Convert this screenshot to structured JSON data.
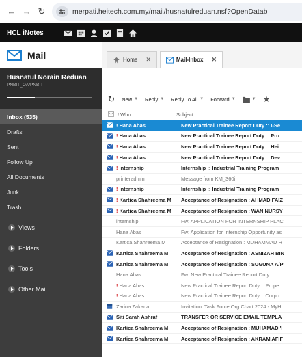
{
  "browser": {
    "url": "merpati.heitech.com.my/mail/husnatulreduan.nsf?OpenDatab"
  },
  "app": {
    "title": "HCL iNotes"
  },
  "sidebar": {
    "mail_title": "Mail",
    "user_name": "Husnatul Norain Reduan",
    "user_sub": "PNBIT_OA/PNBIT",
    "quota_fraction": 0.33,
    "folders": [
      {
        "label": "Inbox (535)",
        "active": true
      },
      {
        "label": "Drafts"
      },
      {
        "label": "Sent"
      },
      {
        "label": "Follow Up"
      },
      {
        "label": "All Documents"
      },
      {
        "label": "Junk"
      },
      {
        "label": "Trash"
      }
    ],
    "sections": [
      {
        "label": "Views"
      },
      {
        "label": "Folders"
      },
      {
        "label": "Tools"
      },
      {
        "label": "Other Mail"
      }
    ]
  },
  "tabs": [
    {
      "label": "Home"
    },
    {
      "label": "Mail-Inbox"
    }
  ],
  "toolbar": {
    "new": "New",
    "reply": "Reply",
    "reply_all": "Reply To All",
    "forward": "Forward"
  },
  "columns": {
    "who": "! Who",
    "subject": "Subject"
  },
  "messages": [
    {
      "who": "Hana Abas",
      "subject": "New Practical Trainee Report Duty  ::  I-Se",
      "important": true,
      "unread": true,
      "selected": true,
      "icon": "mail"
    },
    {
      "who": "Hana Abas",
      "subject": "New Practical Trainee Report Duty  ::  Pro",
      "important": true,
      "unread": true,
      "icon": "mail"
    },
    {
      "who": "Hana Abas",
      "subject": "New Practical Trainee Report Duty  ::  Hei",
      "important": true,
      "unread": true,
      "icon": "mail"
    },
    {
      "who": "Hana Abas",
      "subject": "New Practical Trainee Report Duty  ::  Dev",
      "important": true,
      "unread": true,
      "icon": "mail"
    },
    {
      "who": "internship",
      "subject": "Internship  ::  Industrial Training Program",
      "important": true,
      "unread": true,
      "icon": "mail"
    },
    {
      "who": "printeradmin",
      "subject": "Message from KM_360i",
      "important": false,
      "unread": false,
      "icon": "none"
    },
    {
      "who": "internship",
      "subject": "Internship  ::  Industrial Training Program",
      "important": true,
      "unread": true,
      "icon": "mail"
    },
    {
      "who": "Kartica Shahreema M",
      "subject": "Acceptance of Resignation : AHMAD FAIZ",
      "important": true,
      "unread": true,
      "icon": "mail"
    },
    {
      "who": "Kartica Shahreema M",
      "subject": "Acceptance of Resignation : WAN NURSY",
      "important": true,
      "unread": true,
      "icon": "mail"
    },
    {
      "who": "internship",
      "subject": "Fw: APPLICATION FOR INTERNSHIP PLAC",
      "important": false,
      "unread": false,
      "icon": "none"
    },
    {
      "who": "Hana Abas",
      "subject": "Fw: Application for Internship Opportunity as",
      "important": false,
      "unread": false,
      "icon": "none"
    },
    {
      "who": "Kartica Shahreema M",
      "subject": "Acceptance of Resignation : MUHAMMAD H",
      "important": false,
      "unread": false,
      "icon": "none"
    },
    {
      "who": "Kartica Shahreema M",
      "subject": "Acceptance of Resignation : ASNIZAH BIN",
      "important": false,
      "unread": true,
      "icon": "mail"
    },
    {
      "who": "Kartica Shahreema M",
      "subject": "Acceptance of Resignation : SUGUNA A/P",
      "important": false,
      "unread": true,
      "icon": "mail"
    },
    {
      "who": "Hana Abas",
      "subject": "Fw: New Practical Trainee Report Duty",
      "important": false,
      "unread": false,
      "icon": "none"
    },
    {
      "who": "Hana Abas",
      "subject": "New Practical Trainee Report Duty  ::  Prope",
      "important": true,
      "unread": false,
      "icon": "none"
    },
    {
      "who": "Hana Abas",
      "subject": "New Practical Trainee Report Duty  ::  Corpo",
      "important": true,
      "unread": false,
      "icon": "none"
    },
    {
      "who": "Zarina Zakaria",
      "subject": "Invitation: Task Force Org Chart 2024 - MyHI",
      "important": false,
      "unread": false,
      "icon": "calendar"
    },
    {
      "who": "Siti Sarah Ashraf",
      "subject": "TRANSFER OR SERVICE EMAIL TEMPLA",
      "important": false,
      "unread": true,
      "icon": "mail"
    },
    {
      "who": "Kartica Shahreema M",
      "subject": "Acceptance of Resignation : MUHAMAD 'I",
      "important": false,
      "unread": true,
      "icon": "mail"
    },
    {
      "who": "Kartica Shahreema M",
      "subject": "Acceptance of Resignation : AKRAM AFIF",
      "important": false,
      "unread": true,
      "icon": "mail"
    }
  ]
}
